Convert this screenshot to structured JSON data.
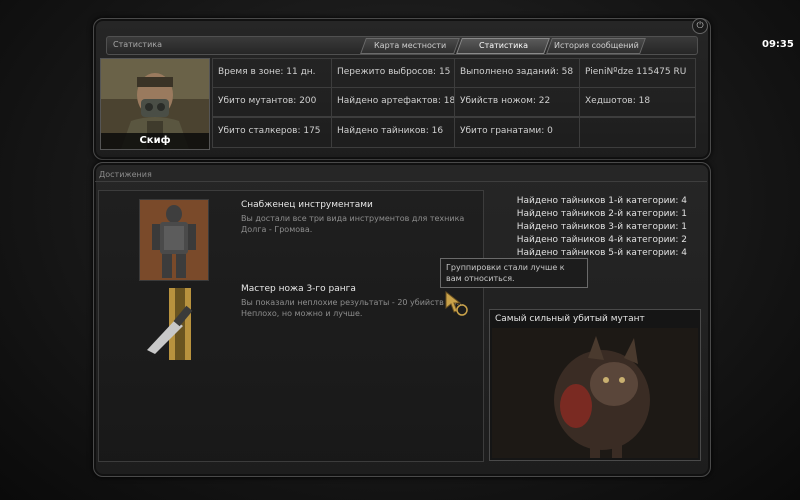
{
  "header": {
    "title": "Статистика",
    "tabs": [
      {
        "label": "Карта местности",
        "active": false
      },
      {
        "label": "Статистика",
        "active": true
      },
      {
        "label": "История сообщений",
        "active": false
      }
    ],
    "clock": "09:35"
  },
  "player": {
    "name": "Скиф"
  },
  "stats": [
    [
      "Время в зоне: 11 дн.",
      "Пережито выбросов: 15",
      "Выполнено заданий: 58",
      "PieniNºdze  115475 RU"
    ],
    [
      "Убито мутантов: 200",
      "Найдено артефактов: 18",
      "Убийств ножом: 22",
      "Хедшотов: 18"
    ],
    [
      "Убито сталкеров: 175",
      "Найдено тайников: 16",
      "Убито гранатами: 0",
      ""
    ]
  ],
  "achievements": {
    "section_title": "Достижения",
    "items": [
      {
        "title": "Снабженец инструментами",
        "desc": "Вы достали все три вида инструментов для техника Долга - Громова."
      },
      {
        "title": "Мастер ножа 3-го ранга",
        "desc": "Вы показали неплохие результаты - 20 убийств но... Неплохо, но можно и лучше."
      }
    ]
  },
  "caches": [
    "Найдено тайников 1-й категории: 4",
    "Найдено тайников 2-й категории: 1",
    "Найдено тайников 3-й категории: 1",
    "Найдено тайников 4-й категории: 2",
    "Найдено тайников 5-й категории: 4"
  ],
  "tooltip": "Группировки стали лучше к вам относиться.",
  "mutant": {
    "title": "Самый сильный убитый мутант"
  },
  "icons": {
    "power": "power-icon",
    "cursor": "cursor-icon"
  }
}
